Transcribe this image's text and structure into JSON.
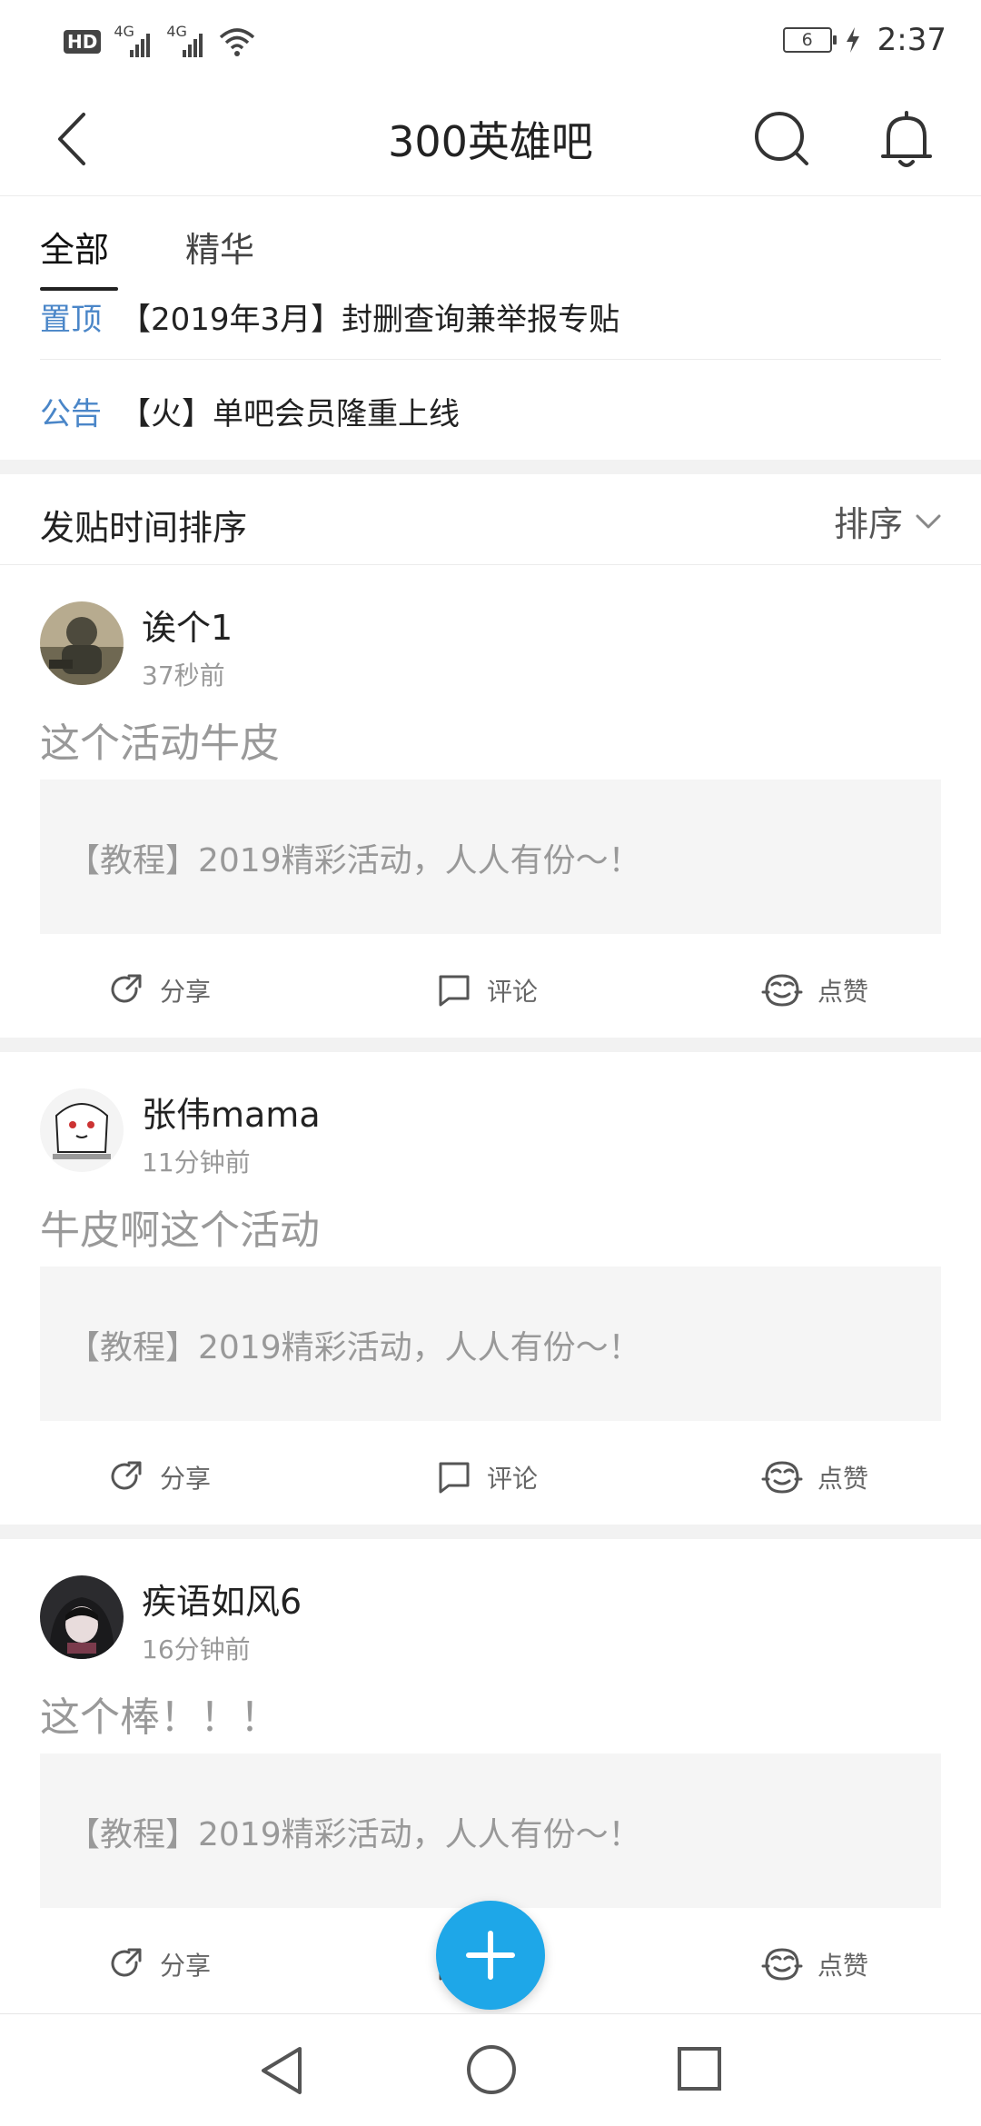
{
  "status_bar": {
    "hd": "HD",
    "network1": "4G",
    "network2": "4G",
    "battery": "6",
    "time": "2:37"
  },
  "header": {
    "title": "300英雄吧",
    "icons": [
      "back-icon",
      "search-icon",
      "bell-icon"
    ]
  },
  "tabs": [
    {
      "label": "全部",
      "selected": true
    },
    {
      "label": "精华",
      "selected": false
    }
  ],
  "pinned": [
    {
      "tag": "置顶",
      "text": "【2019年3月】封删查询兼举报专贴"
    },
    {
      "tag": "公告",
      "text": "【火】单吧会员隆重上线"
    }
  ],
  "sort": {
    "label": "发贴时间排序",
    "button": "排序"
  },
  "posts": [
    {
      "username": "诶个1",
      "time": "37秒前",
      "text": "这个活动牛皮",
      "quote": "【教程】2019精彩活动，人人有份～！",
      "share": "分享",
      "comment": "评论",
      "like": "点赞"
    },
    {
      "username": "张伟mama",
      "time": "11分钟前",
      "text": "牛皮啊这个活动",
      "quote": "【教程】2019精彩活动，人人有份～！",
      "share": "分享",
      "comment": "评论",
      "like": "点赞"
    },
    {
      "username": "疾语如风6",
      "time": "16分钟前",
      "text": "这个棒！！！",
      "quote": "【教程】2019精彩活动，人人有份～！",
      "share": "分享",
      "comment": "评论",
      "like": "点赞"
    }
  ],
  "colors": {
    "accent": "#1ea7e8",
    "tag_blue": "#4a86c8",
    "divider": "#f2f2f2"
  }
}
